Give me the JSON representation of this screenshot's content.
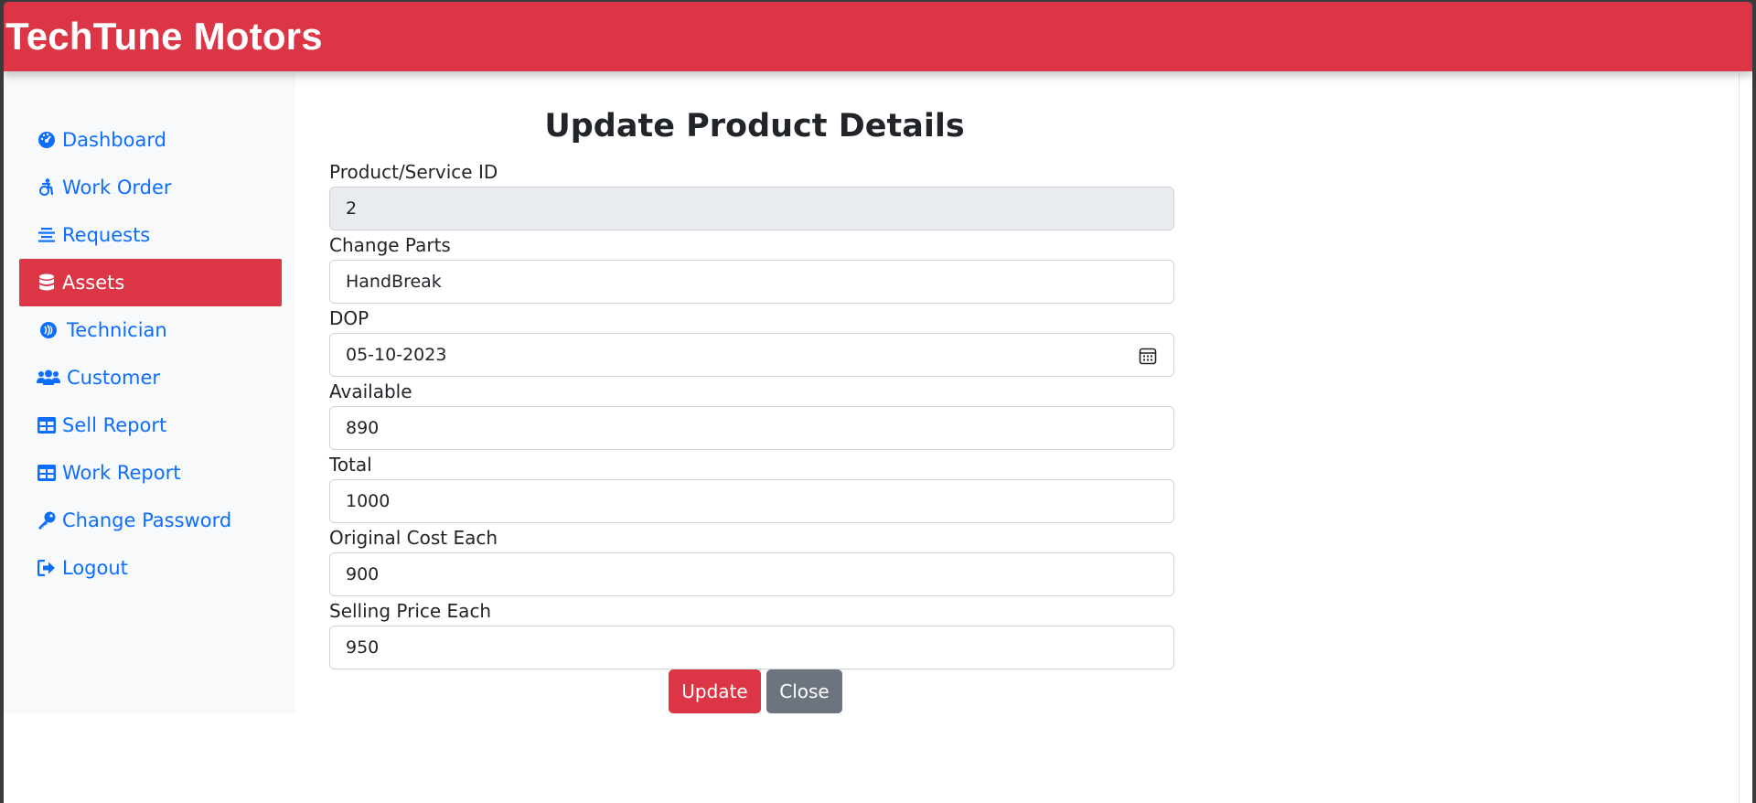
{
  "header": {
    "brand": "TechTune Motors"
  },
  "sidebar": {
    "items": [
      {
        "label": "Dashboard",
        "icon": "dashboard-gauge-icon",
        "active": false
      },
      {
        "label": "Work Order",
        "icon": "accessibility-icon",
        "active": false
      },
      {
        "label": "Requests",
        "icon": "align-center-icon",
        "active": false
      },
      {
        "label": "Assets",
        "icon": "database-icon",
        "active": true
      },
      {
        "label": "Technician",
        "icon": "sound-wave-icon",
        "active": false
      },
      {
        "label": "Customer",
        "icon": "users-icon",
        "active": false
      },
      {
        "label": "Sell Report",
        "icon": "table-icon",
        "active": false
      },
      {
        "label": "Work Report",
        "icon": "table-icon",
        "active": false
      },
      {
        "label": "Change Password",
        "icon": "key-icon",
        "active": false
      },
      {
        "label": "Logout",
        "icon": "sign-out-icon",
        "active": false
      }
    ]
  },
  "form": {
    "title": "Update Product Details",
    "fields": [
      {
        "label": "Product/Service ID",
        "value": "2",
        "disabled": true
      },
      {
        "label": "Change Parts",
        "value": "HandBreak",
        "disabled": false
      },
      {
        "label": "DOP",
        "value": "05-10-2023",
        "disabled": false,
        "type": "date"
      },
      {
        "label": "Available",
        "value": "890",
        "disabled": false
      },
      {
        "label": "Total",
        "value": "1000",
        "disabled": false
      },
      {
        "label": "Original Cost Each",
        "value": "900",
        "disabled": false
      },
      {
        "label": "Selling Price Each",
        "value": "950",
        "disabled": false
      }
    ],
    "buttons": {
      "update": "Update",
      "close": "Close"
    }
  },
  "colors": {
    "brand": "#dc3545",
    "link": "#0d6efd",
    "secondary": "#6c757d",
    "sidebar_bg": "#f8f9fa",
    "disabled_bg": "#e9ecef"
  }
}
